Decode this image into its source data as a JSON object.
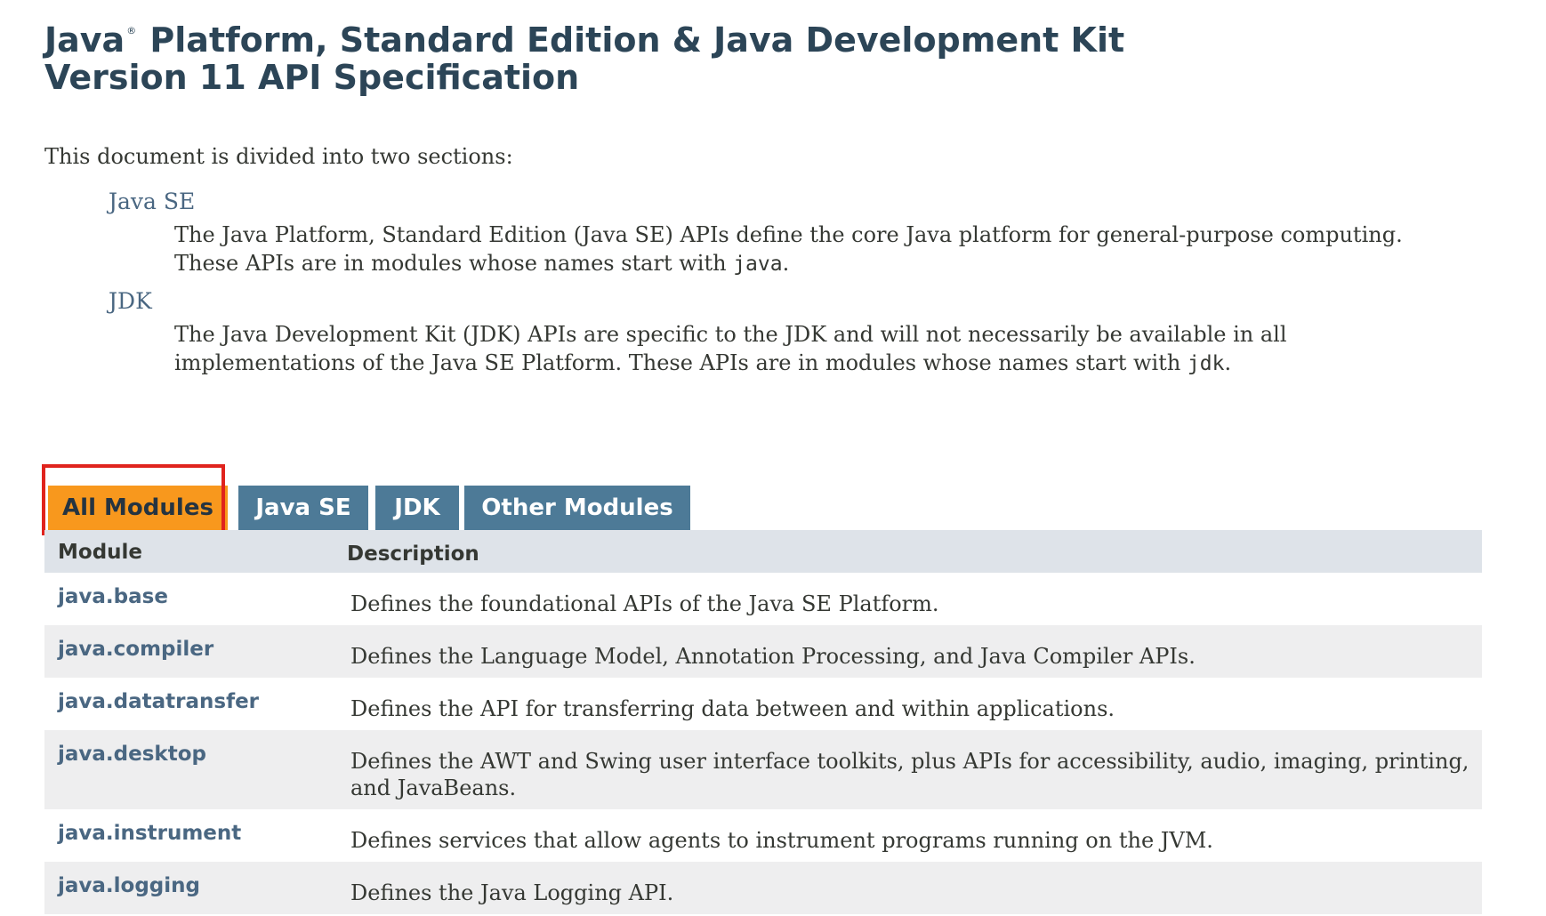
{
  "header": {
    "title_part1": "Java",
    "registered": "®",
    "title_part2": " Platform, Standard Edition & Java Development Kit",
    "title_line2": "Version 11 API Specification"
  },
  "intro": "This document is divided into two sections:",
  "sections": [
    {
      "term": "Java SE",
      "desc_a": "The Java Platform, Standard Edition (Java SE) APIs define the core Java platform for general-purpose computing. These APIs are in modules whose names start with ",
      "desc_code": "java",
      "desc_b": "."
    },
    {
      "term": "JDK",
      "desc_a": "The Java Development Kit (JDK) APIs are specific to the JDK and will not necessarily be available in all implementations of the Java SE Platform. These APIs are in modules whose names start with ",
      "desc_code": "jdk",
      "desc_b": "."
    }
  ],
  "tabs": [
    {
      "label": "All Modules",
      "active": true
    },
    {
      "label": "Java SE",
      "active": false
    },
    {
      "label": "JDK",
      "active": false
    },
    {
      "label": "Other Modules",
      "active": false
    }
  ],
  "table": {
    "headers": [
      "Module",
      "Description"
    ],
    "rows": [
      {
        "module": "java.base",
        "description": "Defines the foundational APIs of the Java SE Platform."
      },
      {
        "module": "java.compiler",
        "description": "Defines the Language Model, Annotation Processing, and Java Compiler APIs."
      },
      {
        "module": "java.datatransfer",
        "description": "Defines the API for transferring data between and within applications."
      },
      {
        "module": "java.desktop",
        "description": "Defines the AWT and Swing user interface toolkits, plus APIs for accessibility, audio, imaging, printing, and JavaBeans."
      },
      {
        "module": "java.instrument",
        "description": "Defines services that allow agents to instrument programs running on the JVM."
      },
      {
        "module": "java.logging",
        "description": "Defines the Java Logging API."
      }
    ]
  },
  "colors": {
    "title": "#2c4557",
    "link": "#4a6782",
    "tab_active": "#f8981d",
    "tab_inactive": "#4d7a97",
    "table_header": "#dee3e9",
    "row_alt": "#eeeeef",
    "highlight": "#e0231d"
  }
}
